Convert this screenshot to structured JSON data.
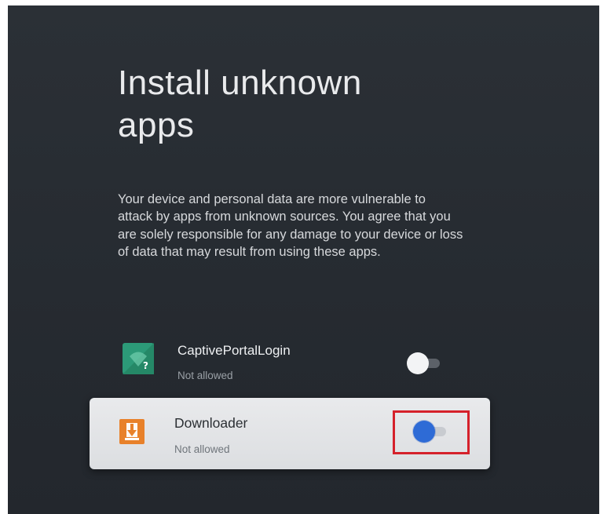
{
  "screen": {
    "title": "Install unknown apps",
    "description": "Your device and personal data are more vulnerable to attack by apps from unknown sources. You agree that you are solely responsible for any damage to your device or loss of data that may result from using these apps."
  },
  "apps": [
    {
      "name": "CaptivePortalLogin",
      "status": "Not allowed",
      "icon": "captive-portal-wifi-question-icon",
      "icon_color": "#2c9a78",
      "toggle_on": false,
      "focused": false
    },
    {
      "name": "Downloader",
      "status": "Not allowed",
      "icon": "downloader-arrow-icon",
      "icon_color": "#e8812a",
      "toggle_on": false,
      "focused": true,
      "highlighted": true
    }
  ],
  "colors": {
    "background": "#262b31",
    "focused_row": "#e3e5e7",
    "highlight_box": "#d5212b",
    "toggle_focus_thumb": "#2e6bd6"
  }
}
